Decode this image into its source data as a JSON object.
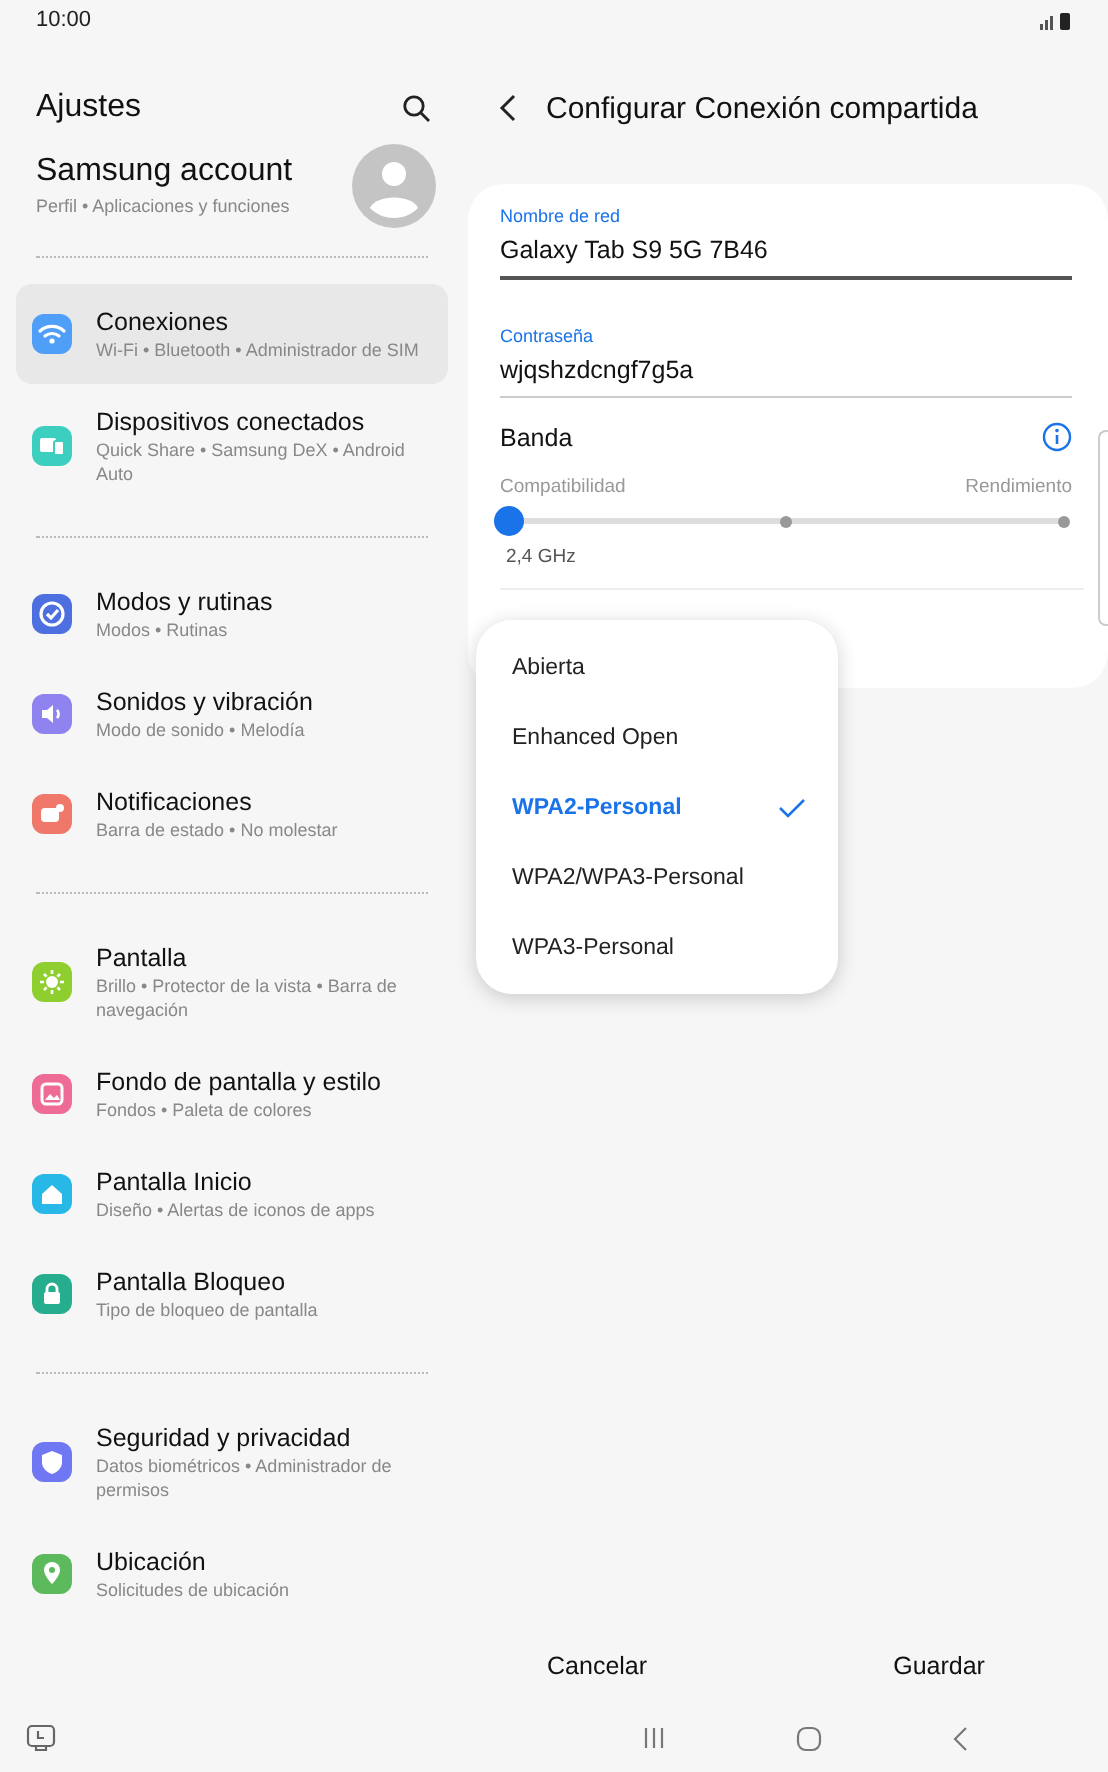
{
  "status_bar": {
    "time": "10:00"
  },
  "sidebar": {
    "title": "Ajustes",
    "account": {
      "name": "Samsung account",
      "subtitle": "Perfil • Aplicaciones y funciones"
    },
    "groups": [
      [
        {
          "title": "Conexiones",
          "subtitle": "Wi-Fi • Bluetooth • Administrador de SIM",
          "color": "#4f9ef8",
          "selected": true
        },
        {
          "title": "Dispositivos conectados",
          "subtitle": "Quick Share • Samsung DeX • Android Auto",
          "color": "#3ccfc0",
          "selected": false
        }
      ],
      [
        {
          "title": "Modos y rutinas",
          "subtitle": "Modos • Rutinas",
          "color": "#4d6fe0",
          "selected": false
        },
        {
          "title": "Sonidos y vibración",
          "subtitle": "Modo de sonido • Melodía",
          "color": "#8f83f0",
          "selected": false
        },
        {
          "title": "Notificaciones",
          "subtitle": "Barra de estado • No molestar",
          "color": "#f0786a",
          "selected": false
        }
      ],
      [
        {
          "title": "Pantalla",
          "subtitle": "Brillo • Protector de la vista • Barra de navegación",
          "color": "#8ecf2f",
          "selected": false
        },
        {
          "title": "Fondo de pantalla y estilo",
          "subtitle": "Fondos • Paleta de colores",
          "color": "#ee6b95",
          "selected": false
        },
        {
          "title": "Pantalla Inicio",
          "subtitle": "Diseño • Alertas de iconos de apps",
          "color": "#27b8e8",
          "selected": false
        },
        {
          "title": "Pantalla Bloqueo",
          "subtitle": "Tipo de bloqueo de pantalla",
          "color": "#25ad8e",
          "selected": false
        }
      ],
      [
        {
          "title": "Seguridad y privacidad",
          "subtitle": "Datos biométricos • Administrador de permisos",
          "color": "#6f77f2",
          "selected": false
        },
        {
          "title": "Ubicación",
          "subtitle": "Solicitudes de ubicación",
          "color": "#5cba5c",
          "selected": false
        }
      ]
    ]
  },
  "detail": {
    "title": "Configurar Conexión compartida",
    "fields": [
      {
        "label": "Nombre de red",
        "value": "Galaxy Tab S9 5G 7B46",
        "focused": true
      },
      {
        "label": "Contraseña",
        "value": "wjqshzdcngf7g5a",
        "focused": false
      }
    ],
    "band": {
      "label": "Banda",
      "left": "Compatibilidad",
      "right": "Rendimiento",
      "level": 0,
      "reading": "2,4 GHz"
    },
    "security_menu": [
      {
        "label": "Abierta",
        "selected": false
      },
      {
        "label": "Enhanced Open",
        "selected": false
      },
      {
        "label": "WPA2-Personal",
        "selected": true
      },
      {
        "label": "WPA2/WPA3-Personal",
        "selected": false
      },
      {
        "label": "WPA3-Personal",
        "selected": false
      }
    ],
    "buttons": [
      "Cancelar",
      "Guardar"
    ]
  }
}
